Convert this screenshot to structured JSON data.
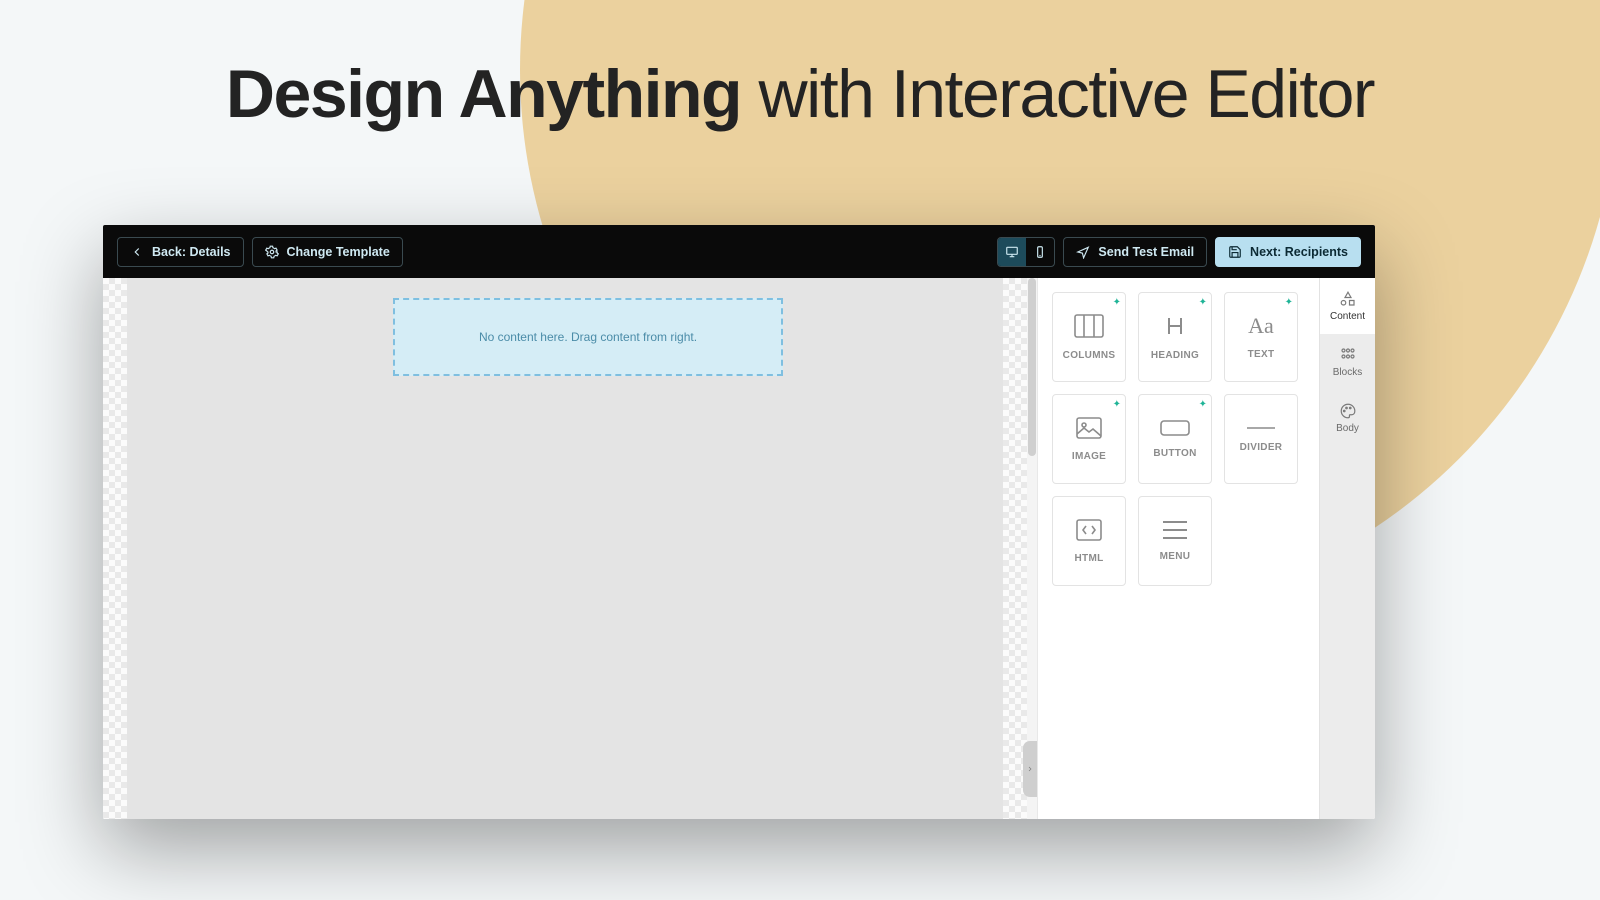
{
  "hero": {
    "part1": "Design Anything",
    "sep": " with ",
    "part2": "Interactive Editor"
  },
  "topbar": {
    "back": "Back: Details",
    "change_template": "Change Template",
    "send_test": "Send Test Email",
    "next": "Next: Recipients"
  },
  "dropzone": {
    "placeholder": "No content here. Drag content from right."
  },
  "rail": {
    "content": "Content",
    "blocks": "Blocks",
    "body": "Body"
  },
  "blocks": {
    "columns": "COLUMNS",
    "heading": "HEADING",
    "text": "TEXT",
    "image": "IMAGE",
    "button": "BUTTON",
    "divider": "DIVIDER",
    "html": "HTML",
    "menu": "MENU"
  }
}
